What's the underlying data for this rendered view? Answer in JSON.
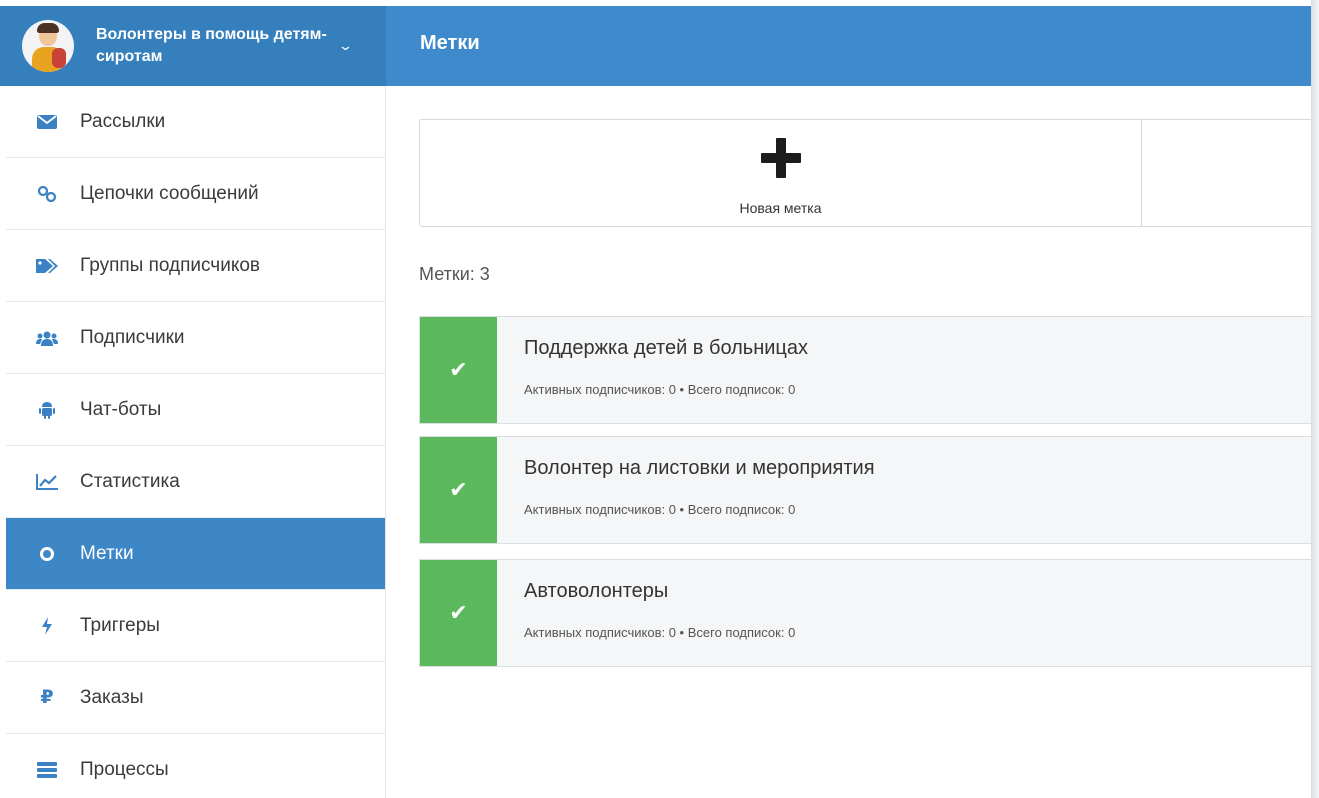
{
  "org": {
    "name": "Волонтеры в помощь детям-сиротам",
    "chevron_icon": "chevron-down-icon"
  },
  "header": {
    "title": "Метки"
  },
  "colors": {
    "header": "#3e8acc",
    "brand": "#367fbd",
    "active": "#3e87c7",
    "check": "#5cb85c"
  },
  "sidebar": {
    "items": [
      {
        "label": "Рассылки",
        "icon": "envelope-icon"
      },
      {
        "label": "Цепочки сообщений",
        "icon": "link-icon"
      },
      {
        "label": "Группы подписчиков",
        "icon": "tags-icon"
      },
      {
        "label": "Подписчики",
        "icon": "users-icon"
      },
      {
        "label": "Чат-боты",
        "icon": "android-icon"
      },
      {
        "label": "Статистика",
        "icon": "line-chart-icon"
      },
      {
        "label": "Метки",
        "icon": "circle-icon",
        "active": true
      },
      {
        "label": "Триггеры",
        "icon": "bolt-icon"
      },
      {
        "label": "Заказы",
        "icon": "ruble-icon"
      },
      {
        "label": "Процессы",
        "icon": "server-icon"
      }
    ]
  },
  "new_tag": {
    "label": "Новая метка",
    "icon": "plus-icon"
  },
  "tags_count": "Метки: 3",
  "tags": [
    {
      "name": "Поддержка детей в больницах",
      "meta": "Активных подписчиков: 0 • Всего подписок: 0"
    },
    {
      "name": "Волонтер на листовки и мероприятия",
      "meta": "Активных подписчиков: 0 • Всего подписок: 0"
    },
    {
      "name": "Автоволонтеры",
      "meta": "Активных подписчиков: 0 • Всего подписок: 0"
    }
  ]
}
